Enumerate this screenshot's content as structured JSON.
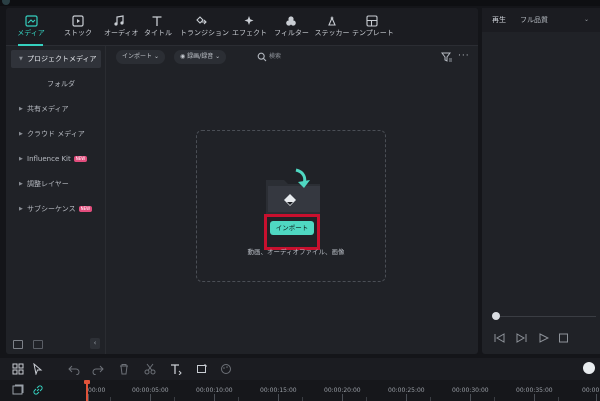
{
  "toolbar": {
    "items": [
      {
        "label": "メディア",
        "icon": "media-icon"
      },
      {
        "label": "ストック",
        "icon": "stock-icon"
      },
      {
        "label": "オーディオ",
        "icon": "audio-note-icon"
      },
      {
        "label": "タイトル",
        "icon": "title-t-icon"
      },
      {
        "label": "トランジション",
        "icon": "transition-icon"
      },
      {
        "label": "エフェクト",
        "icon": "effect-sparkle-icon"
      },
      {
        "label": "フィルター",
        "icon": "filter-circles-icon"
      },
      {
        "label": "ステッカー",
        "icon": "sticker-icon"
      },
      {
        "label": "テンプレート",
        "icon": "template-grid-icon"
      }
    ],
    "active_index": 0,
    "accent": "#35d0bf"
  },
  "sidebar": {
    "items": [
      {
        "label": "プロジェクトメディア",
        "selected": true
      },
      {
        "label": "フォルダ",
        "sub": true
      },
      {
        "label": "共有メディア"
      },
      {
        "label": "クラウド メディア"
      },
      {
        "label": "Influence Kit",
        "badge": "NEW"
      },
      {
        "label": "調整レイヤー"
      },
      {
        "label": "サブシーケンス",
        "badge": "NEW"
      }
    ]
  },
  "filterbar": {
    "import_label": "インポート",
    "record_label": "録画/録音",
    "search_placeholder": "検索"
  },
  "dropzone": {
    "import_button": "インポート",
    "hint": "動画、オーディオファイル、画像",
    "highlight_color": "#c8102e"
  },
  "player": {
    "label": "再生",
    "quality": "フル品質"
  },
  "timeline": {
    "ruler_labels": [
      "00:00",
      "00:00:05:00",
      "00:00:10:00",
      "00:00:15:00",
      "00:00:20:00",
      "00:00:25:00",
      "00:00:30:00",
      "00:00:35:00",
      "00:00"
    ]
  }
}
